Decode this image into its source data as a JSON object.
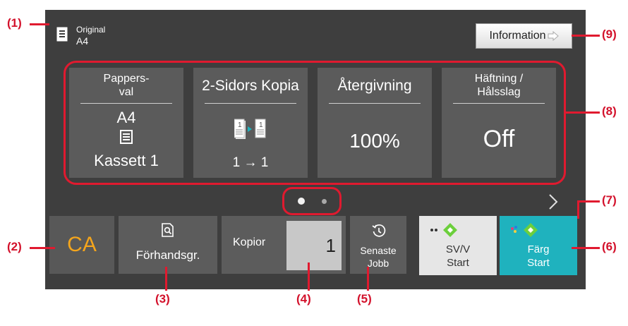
{
  "original": {
    "label": "Original",
    "size": "A4"
  },
  "info_button": {
    "label": "Information"
  },
  "tiles": [
    {
      "title": "Pappers-\nval",
      "value_top": "A4",
      "value_bottom": "Kassett 1"
    },
    {
      "title": "2-Sidors Kopia",
      "value_bottom": "1 → 1"
    },
    {
      "title": "Återgivning",
      "value": "100%"
    },
    {
      "title": "Häftning /\nHålsslag",
      "value": "Off"
    }
  ],
  "bottom": {
    "ca_label": "CA",
    "preview_label": "Förhandsgr.",
    "copies_label": "Kopior",
    "copies_value": "1",
    "recent_label": "Senaste\nJobb",
    "bw_start": "SV/V\nStart",
    "color_start": "Färg\nStart"
  },
  "callouts": {
    "c1": "(1)",
    "c2": "(2)",
    "c3": "(3)",
    "c4": "(4)",
    "c5": "(5)",
    "c6": "(6)",
    "c7": "(7)",
    "c8": "(8)",
    "c9": "(9)"
  },
  "colors": {
    "panel": "#3e3e3e",
    "tile": "#5b5b5b",
    "accent": "#e01a2f",
    "ca": "#f4a51c",
    "color_start_bg": "#1fb2be",
    "bw_start_bg": "#e6e6e6"
  },
  "icons": [
    "document-icon",
    "tray-icon",
    "duplex-copy-icon",
    "preview-icon",
    "history-icon",
    "start-diamond-icon",
    "next-page-chevron-icon",
    "page-dot-icon"
  ]
}
